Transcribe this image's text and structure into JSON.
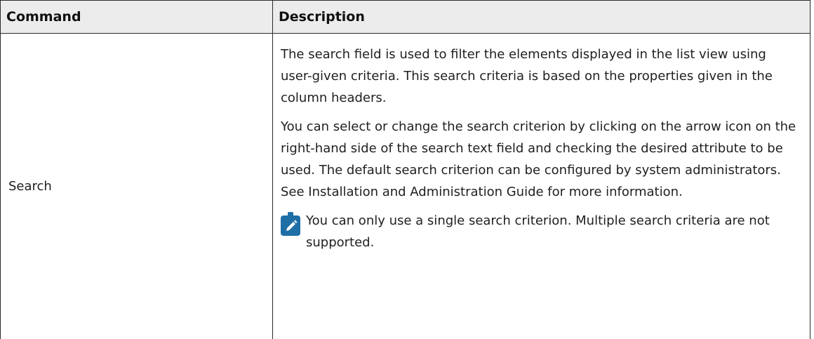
{
  "table": {
    "headers": {
      "command": "Command",
      "description": "Description"
    },
    "rows": [
      {
        "command": "Search",
        "paragraphs": [
          "The search field is used to filter the elements displayed in the list view using user-given criteria. This search criteria is based on the properties given in the column headers.",
          "You can select or change the search criterion by clicking on the arrow icon on the right-hand side of the search text field and checking the desired attribute to be used. The default search criterion can be configured by system administrators. See Installation and Administration Guide for more information."
        ],
        "note": {
          "icon": "pencil-note-icon",
          "text": "You can only use a single search criterion. Multiple search criteria are not supported."
        }
      }
    ]
  },
  "colors": {
    "header_background": "#ececec",
    "border": "#2b2b2b",
    "note_icon": "#1f6fa6"
  }
}
